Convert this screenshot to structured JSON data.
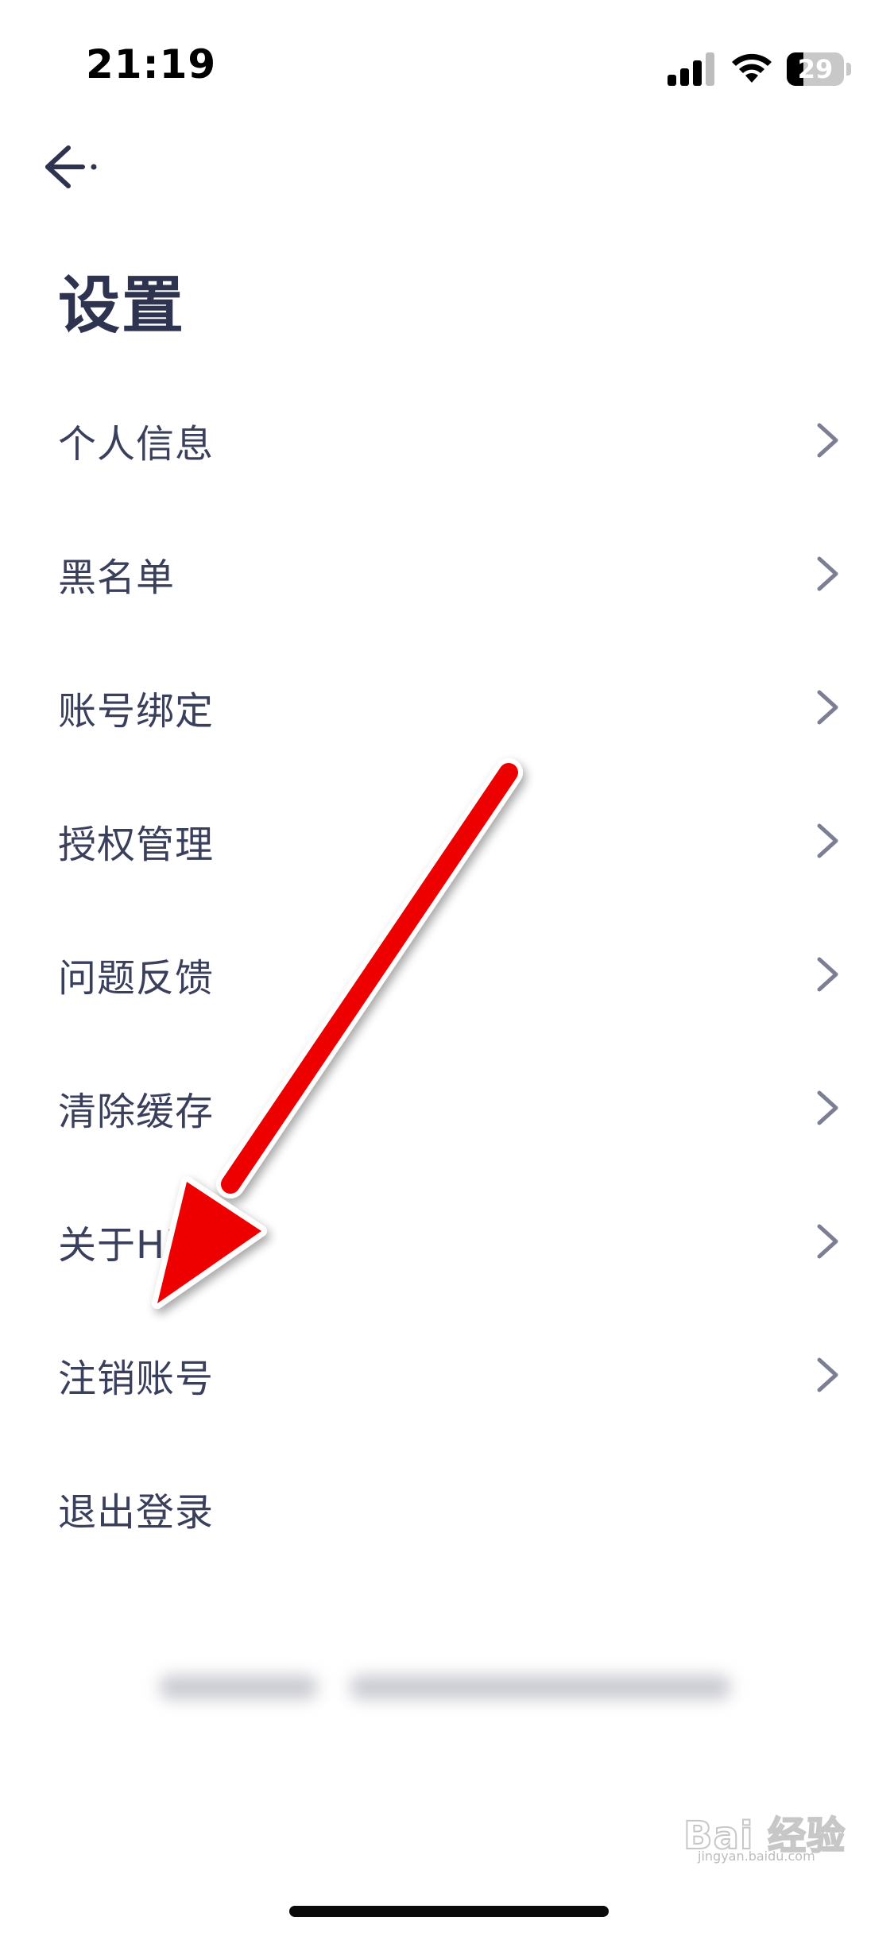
{
  "status_bar": {
    "time": "21:19",
    "battery_level": "29",
    "battery_fraction": 0.29
  },
  "header": {
    "back_icon": "arrow-left-icon",
    "title": "设置"
  },
  "menu": {
    "items": [
      {
        "label": "个人信息",
        "has_chevron": true
      },
      {
        "label": "黑名单",
        "has_chevron": true
      },
      {
        "label": "账号绑定",
        "has_chevron": true
      },
      {
        "label": "授权管理",
        "has_chevron": true
      },
      {
        "label": "问题反馈",
        "has_chevron": true
      },
      {
        "label": "清除缓存",
        "has_chevron": true
      },
      {
        "label": "关于Hi",
        "has_chevron": true
      },
      {
        "label": "注销账号",
        "has_chevron": true
      },
      {
        "label": "退出登录",
        "has_chevron": false
      }
    ]
  },
  "annotation": {
    "color": "#ee0000"
  },
  "watermark": {
    "text": "Bai 经验",
    "sub": "jingyan.baidu.com"
  },
  "colors": {
    "text_primary": "#2e3350",
    "chevron": "#7c7f93",
    "background": "#ffffff"
  }
}
